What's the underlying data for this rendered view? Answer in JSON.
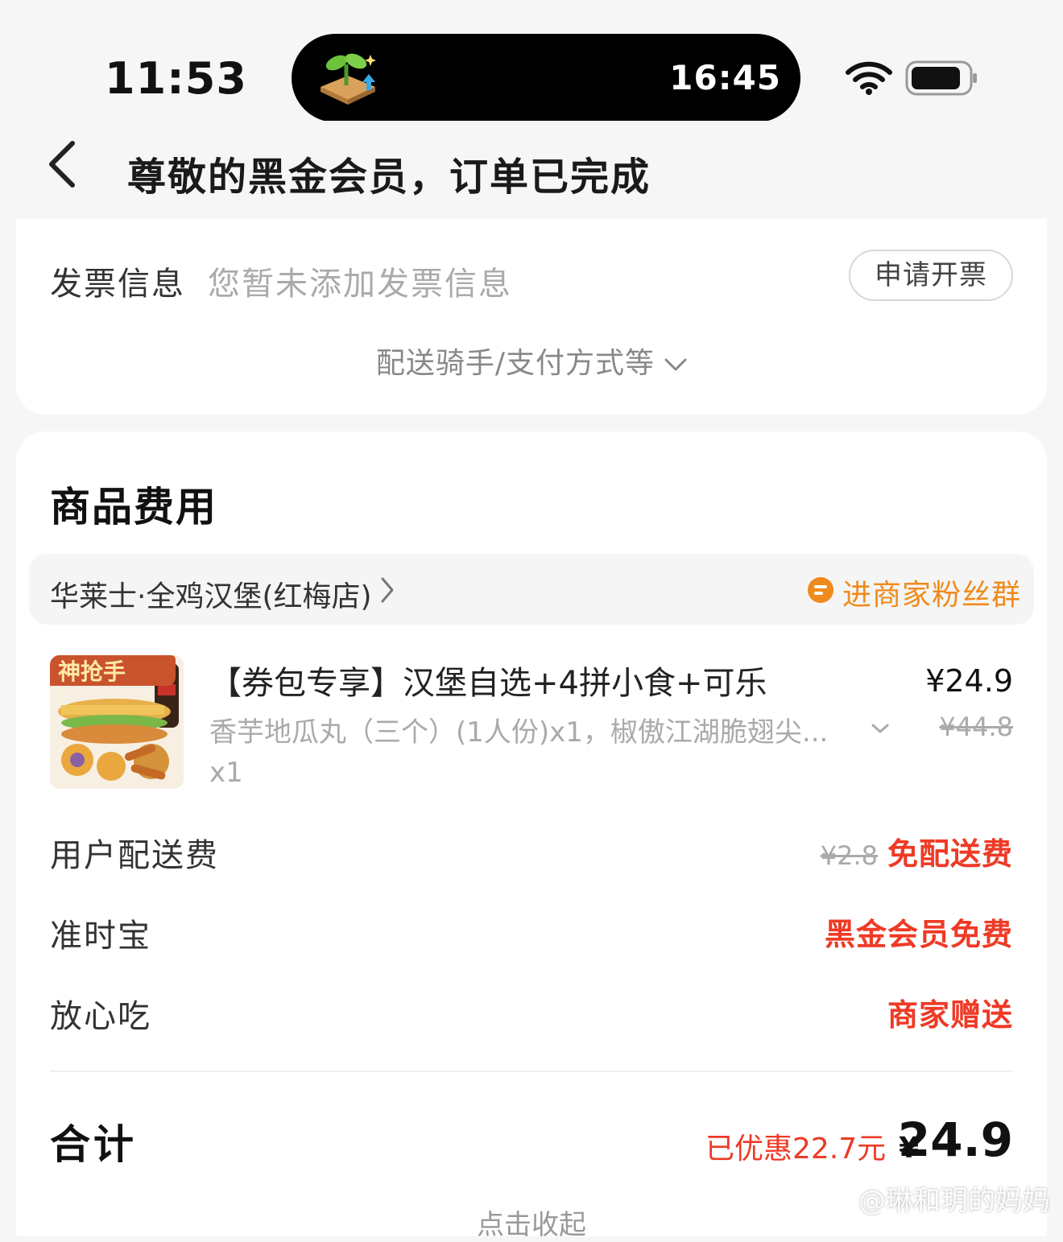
{
  "status_bar": {
    "time": "11:53",
    "island_time": "16:45"
  },
  "nav": {
    "title": "尊敬的黑金会员，订单已完成"
  },
  "invoice": {
    "label": "发票信息",
    "value": "您暂未添加发票信息",
    "button": "申请开票",
    "expand_label": "配送骑手/支付方式等"
  },
  "fees": {
    "section_title": "商品费用",
    "store": {
      "name": "华莱士·全鸡汉堡(红梅店)",
      "fan_group": "进商家粉丝群"
    },
    "product": {
      "badge": "神抢手",
      "name": "【券包专享】汉堡自选+4拼小食+可乐",
      "spec": "香芋地瓜丸（三个）(1人份)x1，椒傲江湖脆翅尖...",
      "qty": "x1",
      "price": "¥24.9",
      "original_price": "¥44.8"
    },
    "rows": [
      {
        "label": "用户配送费",
        "original": "¥2.8",
        "value": "免配送费"
      },
      {
        "label": "准时宝",
        "value": "黑金会员免费"
      },
      {
        "label": "放心吃",
        "value": "商家赠送"
      }
    ],
    "total": {
      "label": "合计",
      "discount": "已优惠22.7元",
      "currency": "¥",
      "amount": "24.9"
    },
    "collapse_label": "点击收起"
  },
  "watermark": "@琳和玥的妈妈",
  "colors": {
    "accent_red": "#ee3a26",
    "accent_orange": "#f08a1a",
    "background": "#f6f6f6"
  }
}
